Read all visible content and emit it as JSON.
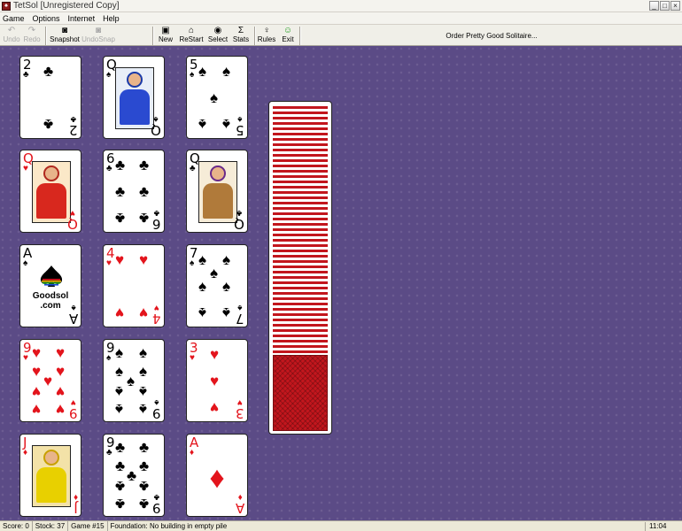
{
  "window": {
    "title": "TetSol [Unregistered Copy]",
    "controls": [
      "_",
      "□",
      "×"
    ]
  },
  "menu": [
    "Game",
    "Options",
    "Internet",
    "Help"
  ],
  "toolbar": {
    "buttons": [
      {
        "label": "Undo",
        "icon": "undo-icon",
        "glyph": "↶",
        "enabled": false
      },
      {
        "label": "Redo",
        "icon": "redo-icon",
        "glyph": "↷",
        "enabled": false
      },
      {
        "label": "Snapshot",
        "icon": "camera-icon",
        "glyph": "◙",
        "enabled": true
      },
      {
        "label": "UndoSnap",
        "icon": "camera-undo-icon",
        "glyph": "◙",
        "enabled": false
      },
      {
        "label": "New",
        "icon": "new-game-icon",
        "glyph": "▣",
        "enabled": true
      },
      {
        "label": "ReStart",
        "icon": "home-icon",
        "glyph": "⌂",
        "enabled": true
      },
      {
        "label": "Select",
        "icon": "select-icon",
        "glyph": "◉",
        "enabled": true
      },
      {
        "label": "Stats",
        "icon": "sigma-icon",
        "glyph": "Σ",
        "enabled": true
      },
      {
        "label": "Rules",
        "icon": "lightbulb-icon",
        "glyph": "♀",
        "enabled": true
      },
      {
        "label": "Exit",
        "icon": "exit-icon",
        "glyph": "☺",
        "enabled": true
      }
    ],
    "order_link": "Order Pretty Good Solitaire..."
  },
  "colors": {
    "table": "#5b4b86",
    "card_red": "#e3141c",
    "card_back": "#c2161d"
  },
  "columns": [
    [
      {
        "rank": "2",
        "suit": "♣",
        "color": "black",
        "kind": "pip"
      },
      {
        "rank": "Q",
        "suit": "♥",
        "color": "red",
        "kind": "face"
      },
      {
        "rank": "A",
        "suit": "♠",
        "color": "black",
        "kind": "logo",
        "logo_text": "Goodsol\n.com"
      },
      {
        "rank": "9",
        "suit": "♥",
        "color": "red",
        "kind": "pip"
      },
      {
        "rank": "J",
        "suit": "♦",
        "color": "red",
        "kind": "face"
      }
    ],
    [
      {
        "rank": "Q",
        "suit": "♠",
        "color": "black",
        "kind": "face"
      },
      {
        "rank": "6",
        "suit": "♣",
        "color": "black",
        "kind": "pip"
      },
      {
        "rank": "4",
        "suit": "♥",
        "color": "red",
        "kind": "pip"
      },
      {
        "rank": "9",
        "suit": "♠",
        "color": "black",
        "kind": "pip"
      },
      {
        "rank": "9",
        "suit": "♣",
        "color": "black",
        "kind": "pip"
      }
    ],
    [
      {
        "rank": "5",
        "suit": "♠",
        "color": "black",
        "kind": "pip"
      },
      {
        "rank": "Q",
        "suit": "♣",
        "color": "black",
        "kind": "face"
      },
      {
        "rank": "7",
        "suit": "♠",
        "color": "black",
        "kind": "pip"
      },
      {
        "rank": "3",
        "suit": "♥",
        "color": "red",
        "kind": "pip"
      },
      {
        "rank": "A",
        "suit": "♦",
        "color": "red",
        "kind": "ace"
      }
    ]
  ],
  "stock": {
    "count": 37
  },
  "status": {
    "score": "Score:  0",
    "stock": "Stock: 37",
    "game": "Game #15",
    "message": "Foundation: No building in empty pile",
    "clock": "11:04"
  }
}
